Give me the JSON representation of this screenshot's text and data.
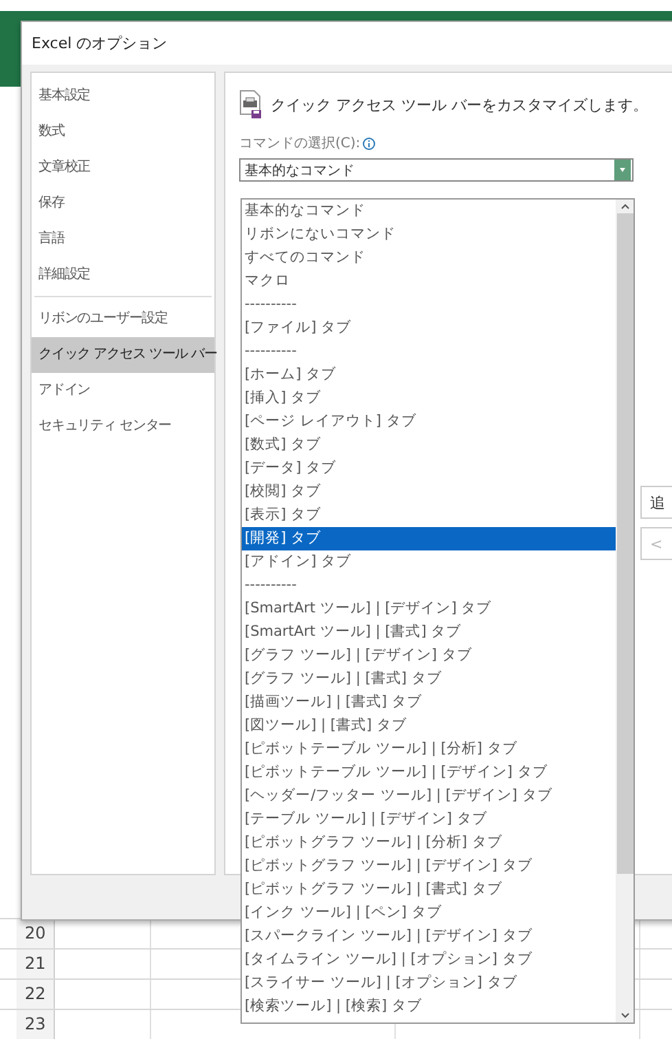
{
  "window": {
    "title": "Excel のオプション"
  },
  "sidebar": {
    "groups": [
      [
        {
          "label": "基本設定",
          "selected": false
        },
        {
          "label": "数式",
          "selected": false
        },
        {
          "label": "文章校正",
          "selected": false
        },
        {
          "label": "保存",
          "selected": false
        },
        {
          "label": "言語",
          "selected": false
        },
        {
          "label": "詳細設定",
          "selected": false
        }
      ],
      [
        {
          "label": "リボンのユーザー設定",
          "selected": false
        },
        {
          "label": "クイック アクセス ツール バー",
          "selected": true
        },
        {
          "label": "アドイン",
          "selected": false
        },
        {
          "label": "セキュリティ センター",
          "selected": false
        }
      ]
    ]
  },
  "header": {
    "title": "クイック アクセス ツール バーをカスタマイズします。"
  },
  "command_select": {
    "label": "コマンドの選択(C):",
    "value": "基本的なコマンド"
  },
  "dropdown": {
    "items": [
      {
        "label": "基本的なコマンド",
        "selected": false
      },
      {
        "label": "リボンにないコマンド",
        "selected": false
      },
      {
        "label": "すべてのコマンド",
        "selected": false
      },
      {
        "label": "マクロ",
        "selected": false
      },
      {
        "label": "----------",
        "selected": false
      },
      {
        "label": "[ファイル] タブ",
        "selected": false
      },
      {
        "label": "----------",
        "selected": false
      },
      {
        "label": "[ホーム] タブ",
        "selected": false
      },
      {
        "label": "[挿入] タブ",
        "selected": false
      },
      {
        "label": "[ページ レイアウト] タブ",
        "selected": false
      },
      {
        "label": "[数式] タブ",
        "selected": false
      },
      {
        "label": "[データ] タブ",
        "selected": false
      },
      {
        "label": "[校閲] タブ",
        "selected": false
      },
      {
        "label": "[表示] タブ",
        "selected": false
      },
      {
        "label": "[開発] タブ",
        "selected": true
      },
      {
        "label": "[アドイン] タブ",
        "selected": false
      },
      {
        "label": "----------",
        "selected": false
      },
      {
        "label": "[SmartArt ツール] | [デザイン] タブ",
        "selected": false
      },
      {
        "label": "[SmartArt ツール] | [書式] タブ",
        "selected": false
      },
      {
        "label": "[グラフ ツール] | [デザイン] タブ",
        "selected": false
      },
      {
        "label": "[グラフ ツール] | [書式] タブ",
        "selected": false
      },
      {
        "label": "[描画ツール] | [書式] タブ",
        "selected": false
      },
      {
        "label": "[図ツール] | [書式] タブ",
        "selected": false
      },
      {
        "label": "[ピボットテーブル ツール] | [分析] タブ",
        "selected": false
      },
      {
        "label": "[ピボットテーブル ツール] | [デザイン] タブ",
        "selected": false
      },
      {
        "label": "[ヘッダー/フッター ツール] | [デザイン] タブ",
        "selected": false
      },
      {
        "label": "[テーブル ツール] | [デザイン] タブ",
        "selected": false
      },
      {
        "label": "[ピボットグラフ ツール] | [分析] タブ",
        "selected": false
      },
      {
        "label": "[ピボットグラフ ツール] | [デザイン] タブ",
        "selected": false
      },
      {
        "label": "[ピボットグラフ ツール] | [書式] タブ",
        "selected": false
      },
      {
        "label": "[インク ツール] | [ペン] タブ",
        "selected": false
      },
      {
        "label": "[スパークライン ツール] | [デザイン] タブ",
        "selected": false
      },
      {
        "label": "[タイムライン ツール] | [オプション] タブ",
        "selected": false
      },
      {
        "label": "[スライサー ツール] | [オプション] タブ",
        "selected": false
      },
      {
        "label": "[検索ツール] | [検索] タブ",
        "selected": false
      }
    ]
  },
  "side_buttons": [
    {
      "label": "追",
      "disabled": false
    },
    {
      "label": "<",
      "disabled": true
    }
  ],
  "sheet": {
    "rows": [
      "20",
      "21",
      "22",
      "23"
    ]
  }
}
